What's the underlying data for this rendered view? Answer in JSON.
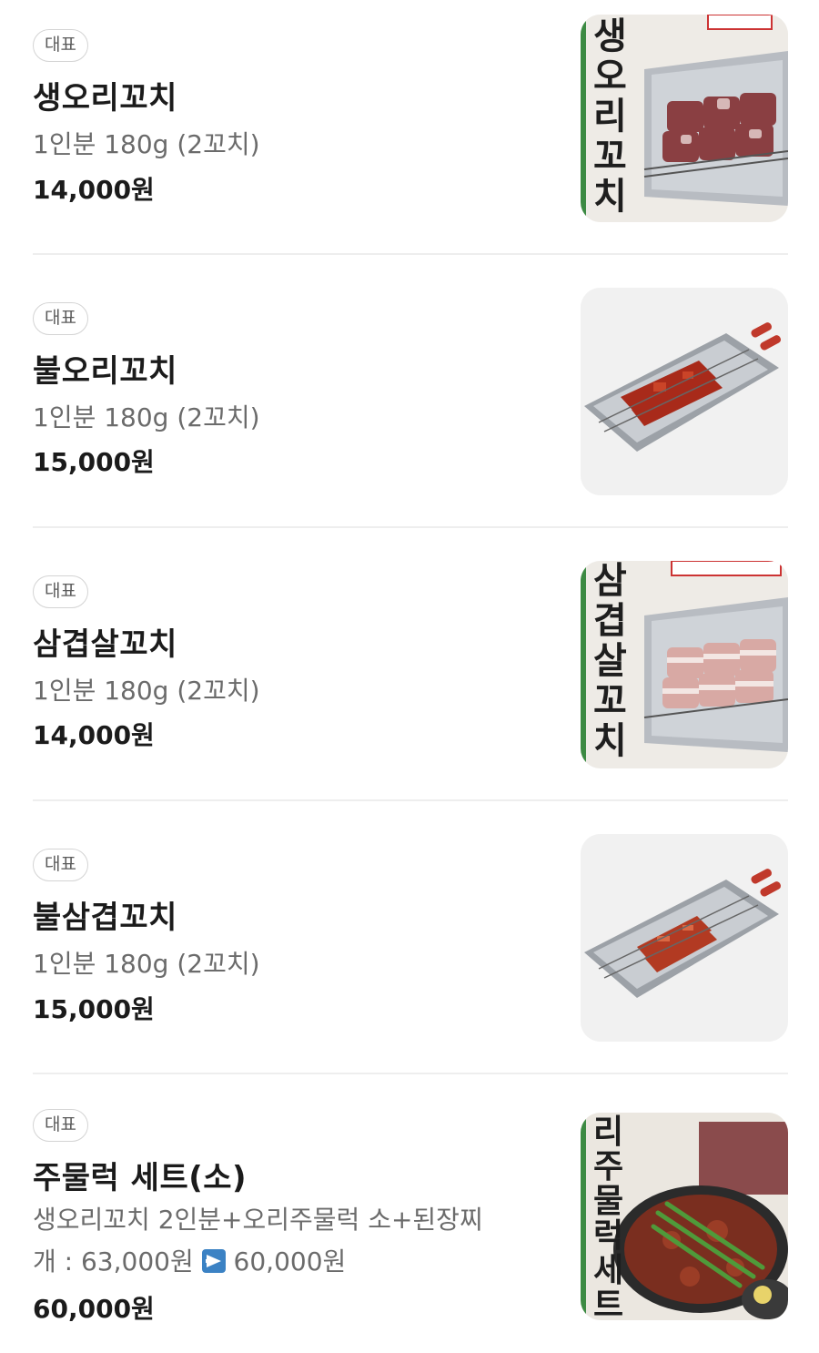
{
  "items": [
    {
      "badge": "대표",
      "name": "생오리꼬치",
      "desc": "1인분 180g (2꼬치)",
      "price": "14,000원",
      "image": "duck-skewer-photo",
      "image_text": "생오리꼬치"
    },
    {
      "badge": "대표",
      "name": "불오리꼬치",
      "desc": "1인분 180g (2꼬치)",
      "price": "15,000원",
      "image": "spicy-duck-skewer-photo"
    },
    {
      "badge": "대표",
      "name": "삼겹살꼬치",
      "desc": "1인분 180g (2꼬치)",
      "price": "14,000원",
      "image": "pork-belly-skewer-photo",
      "image_text": "삼겹살꼬치"
    },
    {
      "badge": "대표",
      "name": "불삼겹꼬치",
      "desc": "1인분 180g (2꼬치)",
      "price": "15,000원",
      "image": "spicy-pork-skewer-photo"
    },
    {
      "badge": "대표",
      "name": "주물럭 세트(소)",
      "desc_line1": "생오리꼬치 2인분+오리주물럭 소+된장찌",
      "desc_line2_a": "개 : 63,000원 ",
      "desc_line2_b": " 60,000원",
      "price": "60,000원",
      "image": "jumulleok-set-photo",
      "image_text": "리주물럭세트"
    }
  ],
  "colors": {
    "badge_border": "#d4d4d4",
    "divider": "#eeeeee",
    "desc": "#6b6b6b",
    "arrow": "#3b82c4"
  }
}
